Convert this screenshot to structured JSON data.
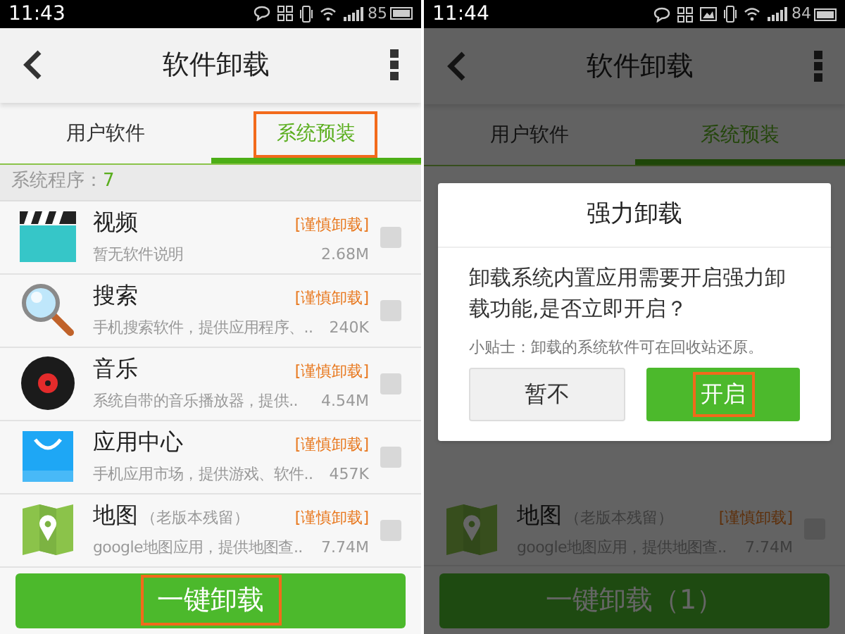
{
  "phones": [
    {
      "status_bar": {
        "time": "11:43",
        "battery": "85"
      },
      "header": {
        "title": "软件卸载"
      },
      "tabs": [
        {
          "label": "用户软件",
          "selected": false,
          "highlighted": false
        },
        {
          "label": "系统预装",
          "selected": true,
          "highlighted": true
        }
      ],
      "count": {
        "label": "系统程序：",
        "value": "7"
      },
      "apps": [
        {
          "kind": "video",
          "name": "视频",
          "tag": "[谨慎卸载]",
          "description": "暂无软件说明",
          "size": "2.68M",
          "checked": false
        },
        {
          "kind": "search",
          "name": "搜索",
          "tag": "[谨慎卸载]",
          "description": "手机搜索软件，提供应用程序、..",
          "size": "240K",
          "checked": false
        },
        {
          "kind": "music",
          "name": "音乐",
          "tag": "[谨慎卸载]",
          "description": "系统自带的音乐播放器，提供..",
          "size": "4.54M",
          "checked": false
        },
        {
          "kind": "store",
          "name": "应用中心",
          "tag": "[谨慎卸载]",
          "description": "手机应用市场，提供游戏、软件..",
          "size": "457K",
          "checked": false
        },
        {
          "kind": "map",
          "name": "地图",
          "note": "（老版本残留）",
          "tag": "[谨慎卸载]",
          "description": "google地图应用，提供地图查..",
          "size": "7.74M",
          "checked": false
        }
      ],
      "action": {
        "label": "一键卸载",
        "highlighted": true
      }
    },
    {
      "status_bar": {
        "time": "11:44",
        "battery": "84"
      },
      "header": {
        "title": "软件卸载"
      },
      "tabs": [
        {
          "label": "用户软件",
          "selected": false,
          "highlighted": false
        },
        {
          "label": "系统预装",
          "selected": true,
          "highlighted": false
        }
      ],
      "apps": [
        {
          "kind": "map",
          "name": "地图",
          "note": "（老版本残留）",
          "tag": "[谨慎卸载]",
          "description": "google地图应用，提供地图查..",
          "size": "7.74M",
          "checked": false
        }
      ],
      "action": {
        "label": "一键卸载（1）",
        "highlighted": false
      },
      "dialog": {
        "title": "强力卸载",
        "message": "卸载系统内置应用需要开启强力卸载功能,是否立即开启？",
        "tip": "小贴士：卸载的系统软件可在回收站还原。",
        "buttons": [
          {
            "label": "暂不",
            "kind": "secondary",
            "highlighted": false
          },
          {
            "label": "开启",
            "kind": "primary",
            "highlighted": true
          }
        ]
      }
    }
  ]
}
